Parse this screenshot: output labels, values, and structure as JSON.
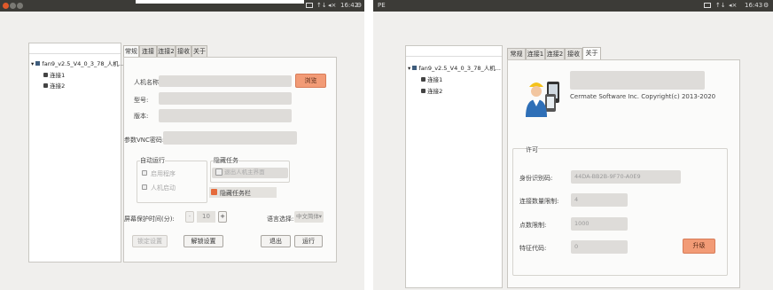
{
  "left": {
    "topbar": {
      "time": "16:42",
      "tray": [
        "↑↓",
        "◂×"
      ]
    },
    "tree": {
      "root": "fan9_v2.5_V4_0_3_78_人机...",
      "children": [
        "连接1",
        "连接2"
      ]
    },
    "tabs": [
      "常规",
      "连接1",
      "连接2",
      "接收",
      "关于"
    ],
    "general": {
      "name_label": "人机名称:",
      "browse_button": "浏览",
      "model_label": "型号:",
      "version_label": "版本:",
      "vnc_label": "参数VNC密码:",
      "autorun_title": "自动运行",
      "enable_program": "启用程序",
      "hmi_startup": "人机启动",
      "hide_group_title": "隐藏任务",
      "hide_option": "退出人机主界面",
      "hide_taskbar": "隐藏任务栏",
      "screensaver_label": "屏幕保护时间(分):",
      "screensaver_minus": "-",
      "screensaver_value": "10",
      "screensaver_plus": "+",
      "language_label": "语言选择:",
      "language_value": "中文简体",
      "lock_button": "锁定设置",
      "unlock_button": "解锁设置",
      "exit_button": "退出",
      "run_button": "运行"
    }
  },
  "right": {
    "window_title": "PE",
    "topbar": {
      "time": "16:43",
      "tray": [
        "↑↓",
        "◂×"
      ]
    },
    "tree": {
      "root": "fan9_v2.5_V4_0_3_78_人机...",
      "children": [
        "连接1",
        "连接2"
      ]
    },
    "tabs": [
      "常规",
      "连接1",
      "连接2",
      "接收",
      "关于"
    ],
    "about": {
      "copyright": "Cermate Software Inc. Copyright(c) 2013-2020",
      "license_title": "许可",
      "device_id_label": "身份识别码:",
      "device_id_value": "44DA-BB2B-9F70-A0E9",
      "connections_label": "连接数量限制:",
      "connections_value": "4",
      "points_label": "点数限制:",
      "points_value": "1000",
      "feature_label": "特征代码:",
      "feature_value": "0",
      "upgrade_button": "升级"
    }
  },
  "colors": {
    "accent": "#f29b76",
    "topbar": "#3c3b37",
    "window": "#f0efed"
  }
}
